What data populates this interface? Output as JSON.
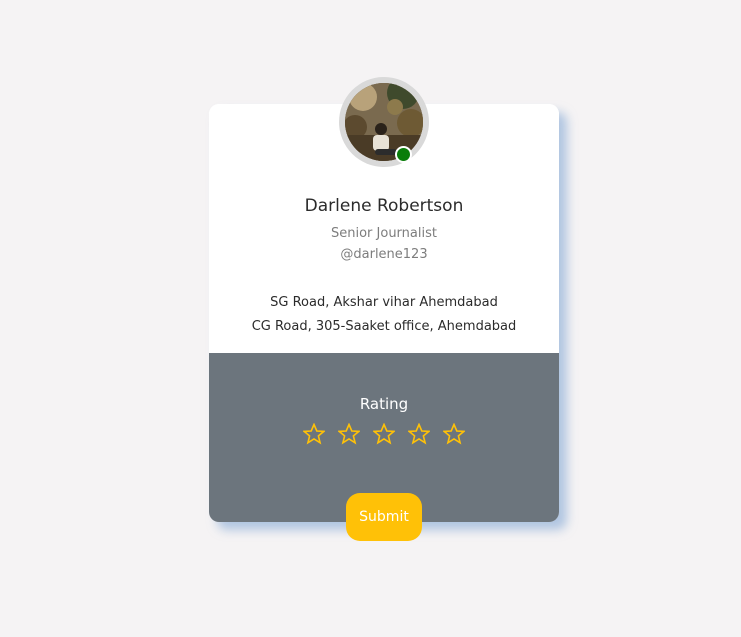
{
  "profile": {
    "name": "Darlene Robertson",
    "role": "Senior Journalist",
    "handle": "@darlene123",
    "online": true,
    "avatar_icon": "user-photo"
  },
  "addresses": [
    "SG Road, Akshar vihar Ahemdabad",
    "CG Road, 305-Saaket office, Ahemdabad"
  ],
  "rating": {
    "label": "Rating",
    "max": 5,
    "value": 0,
    "star_icon": "star-outline-icon"
  },
  "submit_label": "Submit",
  "colors": {
    "star": "#ffc107",
    "submit_bg": "#ffc107",
    "bottom_panel": "#6c757d",
    "status_online": "#0a7d0a",
    "page_bg": "#f5f3f4"
  }
}
